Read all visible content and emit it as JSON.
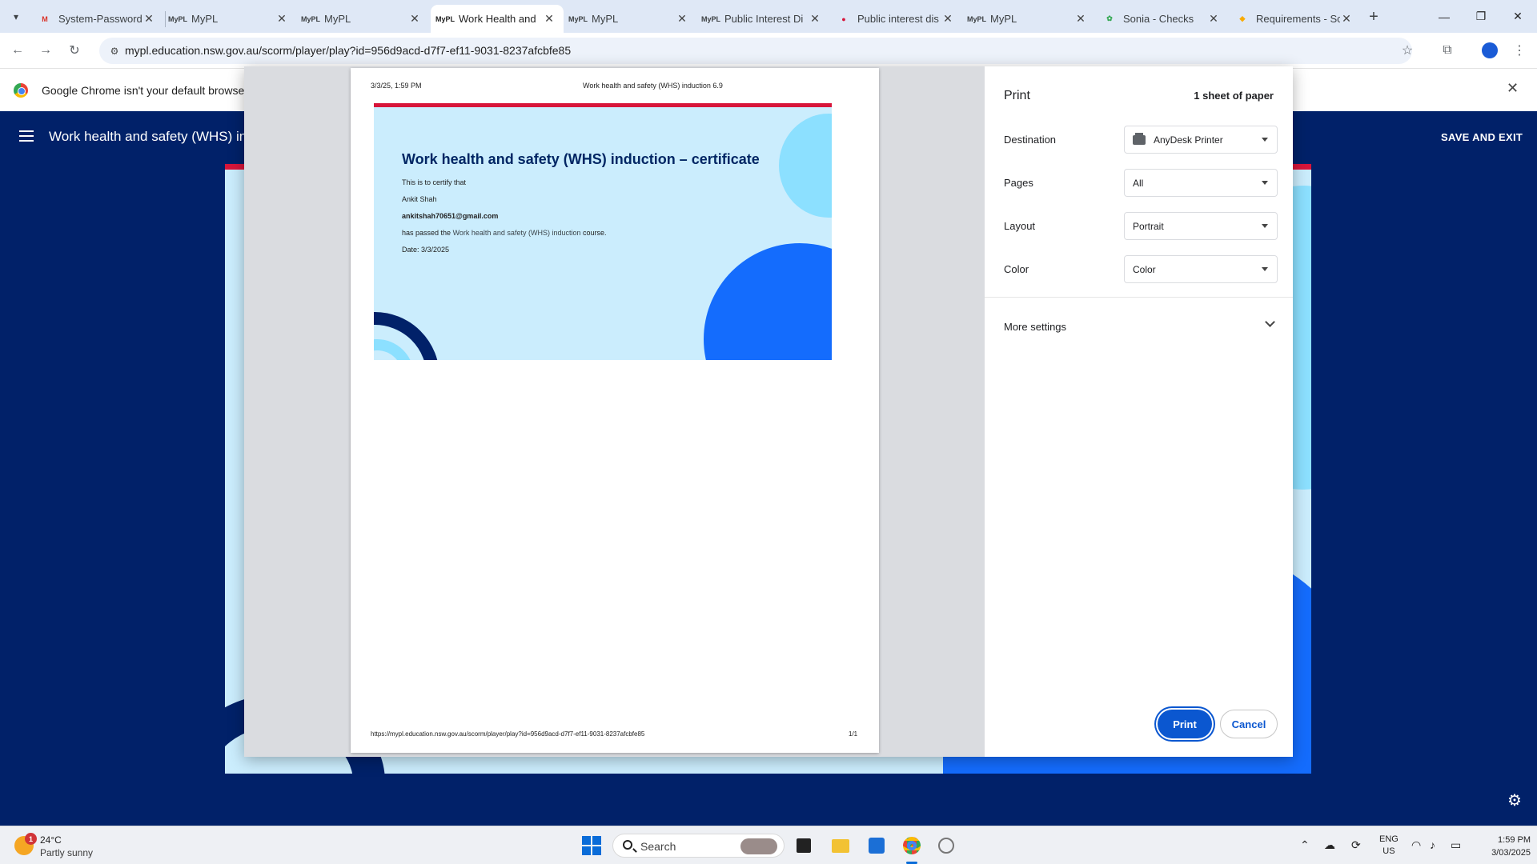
{
  "browser": {
    "tabs": [
      {
        "title": "System-Password",
        "favicon": "gmail-icon"
      },
      {
        "title": "MyPL",
        "favicon": "mypl-icon"
      },
      {
        "title": "MyPL",
        "favicon": "mypl-icon"
      },
      {
        "title": "Work Health and",
        "favicon": "mypl-icon",
        "active": true
      },
      {
        "title": "MyPL",
        "favicon": "mypl-icon"
      },
      {
        "title": "Public Interest Di",
        "favicon": "mypl-icon"
      },
      {
        "title": "Public interest dis",
        "favicon": "nsw-icon"
      },
      {
        "title": "MyPL",
        "favicon": "mypl-icon"
      },
      {
        "title": "Sonia - Checks",
        "favicon": "leaf-icon"
      },
      {
        "title": "Requirements - Sc",
        "favicon": "shield-icon"
      }
    ],
    "url": "mypl.education.nsw.gov.au/scorm/player/play?id=956d9acd-d7f7-ef11-9031-8237afcbfe85",
    "infobar_text": "Google Chrome isn't your default browser"
  },
  "site": {
    "title": "Work health and safety (WHS) induction",
    "save_exit": "SAVE AND EXIT"
  },
  "print_preview": {
    "header_date": "3/3/25, 1:59 PM",
    "header_title": "Work health and safety (WHS) induction 6.9",
    "certificate": {
      "title": "Work health and safety (WHS) induction – certificate",
      "certify": "This is to certify that",
      "name": "Ankit Shah",
      "email": "ankitshah70651@gmail.com",
      "passed_prefix": "has passed the",
      "course": "Work health and safety (WHS) induction",
      "passed_suffix": "course.",
      "date": "Date: 3/3/2025"
    },
    "footer_url": "https://mypl.education.nsw.gov.au/scorm/player/play?id=956d9acd-d7f7-ef11-9031-8237afcbfe85",
    "page_count": "1/1"
  },
  "print_settings": {
    "title": "Print",
    "sheets": "1 sheet of paper",
    "destination_label": "Destination",
    "destination_value": "AnyDesk Printer",
    "pages_label": "Pages",
    "pages_value": "All",
    "layout_label": "Layout",
    "layout_value": "Portrait",
    "color_label": "Color",
    "color_value": "Color",
    "more_settings": "More settings",
    "print_button": "Print",
    "cancel_button": "Cancel"
  },
  "taskbar": {
    "weather_badge": "1",
    "temperature": "24°C",
    "condition": "Partly sunny",
    "search_placeholder": "Search",
    "lang_top": "ENG",
    "lang_bottom": "US",
    "time": "1:59 PM",
    "date": "3/03/2025"
  },
  "colors": {
    "site_navy": "#012169",
    "nsw_red": "#d7153a",
    "light_blue": "#cbedfd",
    "bright_blue": "#146cfd",
    "chrome_blue": "#0b57d0"
  }
}
